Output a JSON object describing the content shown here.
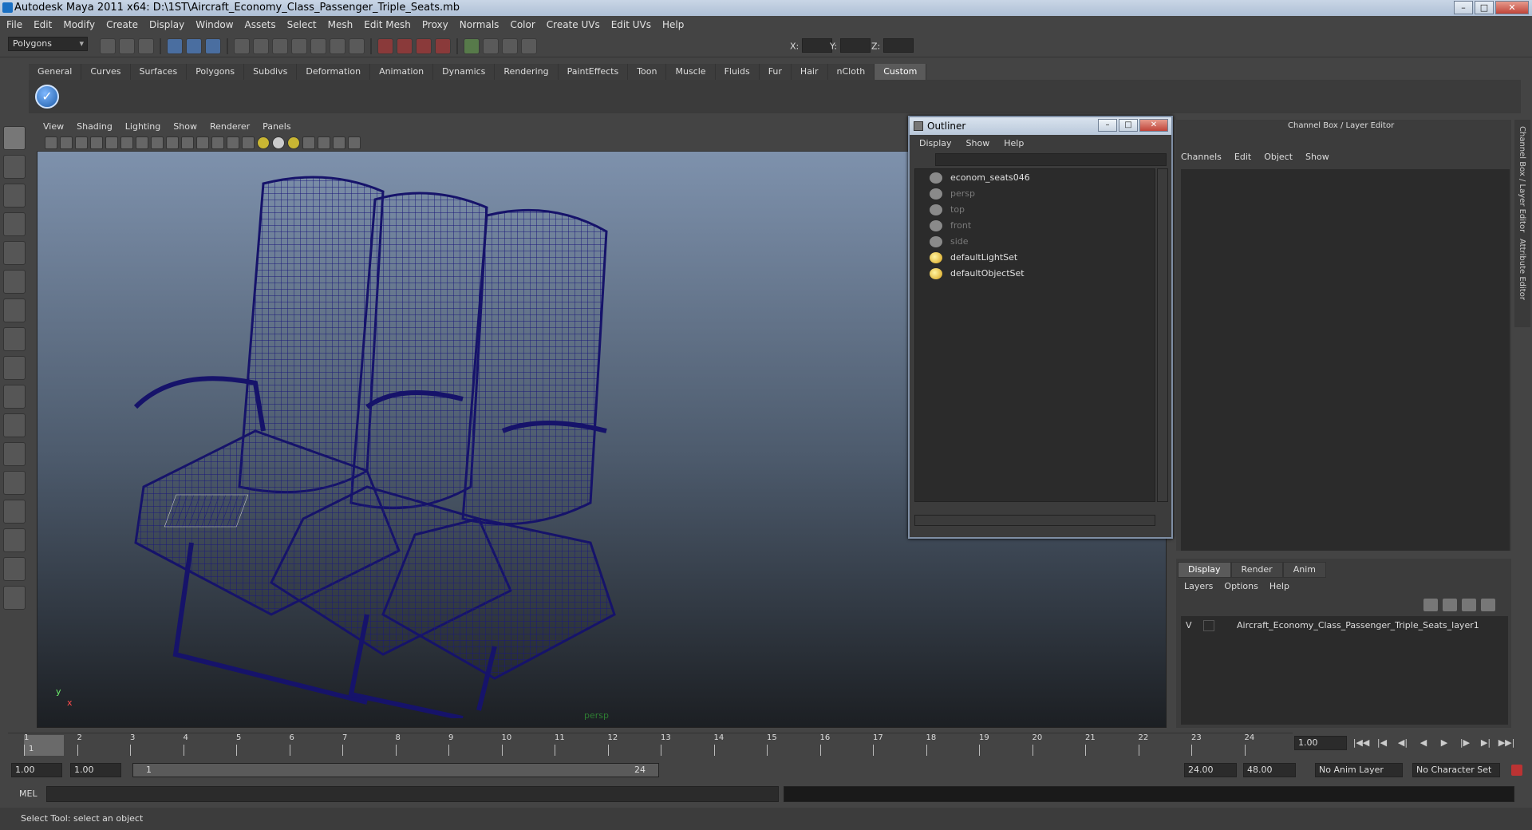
{
  "window": {
    "title": "Autodesk Maya 2011 x64: D:\\1ST\\Aircraft_Economy_Class_Passenger_Triple_Seats.mb"
  },
  "menus": [
    "File",
    "Edit",
    "Modify",
    "Create",
    "Display",
    "Window",
    "Assets",
    "Select",
    "Mesh",
    "Edit Mesh",
    "Proxy",
    "Normals",
    "Color",
    "Create UVs",
    "Edit UVs",
    "Help"
  ],
  "toolbar": {
    "mode": "Polygons",
    "x_label": "X:",
    "y_label": "Y:",
    "z_label": "Z:"
  },
  "shelf_tabs": [
    "General",
    "Curves",
    "Surfaces",
    "Polygons",
    "Subdivs",
    "Deformation",
    "Animation",
    "Dynamics",
    "Rendering",
    "PaintEffects",
    "Toon",
    "Muscle",
    "Fluids",
    "Fur",
    "Hair",
    "nCloth",
    "Custom"
  ],
  "shelf_active": "Custom",
  "viewport": {
    "menu": [
      "View",
      "Shading",
      "Lighting",
      "Show",
      "Renderer",
      "Panels"
    ],
    "camera": "persp",
    "axis_y": "y",
    "axis_x": "x",
    "wire_color": "#1c1a7a"
  },
  "outliner": {
    "title": "Outliner",
    "menu": [
      "Display",
      "Show",
      "Help"
    ],
    "items": [
      {
        "label": "econom_seats046",
        "dim": false
      },
      {
        "label": "persp",
        "dim": true
      },
      {
        "label": "top",
        "dim": true
      },
      {
        "label": "front",
        "dim": true
      },
      {
        "label": "side",
        "dim": true
      },
      {
        "label": "defaultLightSet",
        "dim": false
      },
      {
        "label": "defaultObjectSet",
        "dim": false
      }
    ]
  },
  "channel_box": {
    "title": "Channel Box / Layer Editor",
    "menu": [
      "Channels",
      "Edit",
      "Object",
      "Show"
    ],
    "side_tabs": [
      "Channel Box / Layer Editor",
      "Attribute Editor"
    ]
  },
  "layer_editor": {
    "tabs": [
      "Display",
      "Render",
      "Anim"
    ],
    "menu": [
      "Layers",
      "Options",
      "Help"
    ],
    "layer": {
      "visible": "V",
      "name": "Aircraft_Economy_Class_Passenger_Triple_Seats_layer1"
    }
  },
  "timeline": {
    "ticks": [
      "1",
      "2",
      "3",
      "4",
      "5",
      "6",
      "7",
      "8",
      "9",
      "10",
      "11",
      "12",
      "13",
      "14",
      "15",
      "16",
      "17",
      "18",
      "19",
      "20",
      "21",
      "22",
      "23",
      "24"
    ],
    "current_frame": "1.00",
    "cursor_frame": "1"
  },
  "range": {
    "start": "1.00",
    "inner_start": "1.00",
    "slider_start": "1",
    "slider_end": "24",
    "end": "24.00",
    "max": "48.00",
    "anim_layer": "No Anim Layer",
    "char_set": "No Character Set"
  },
  "mel": {
    "label": "MEL"
  },
  "status": {
    "text": "Select Tool: select an object"
  }
}
